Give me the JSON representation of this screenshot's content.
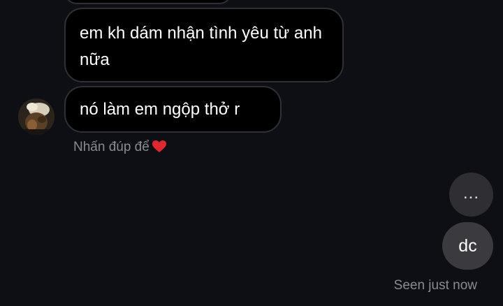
{
  "messages": [
    {
      "side": "incoming",
      "text": "em kh dám nhận tình yêu từ anh nữa"
    },
    {
      "side": "incoming",
      "text": "nó làm em ngộp thở r"
    },
    {
      "side": "outgoing",
      "text": "dc"
    }
  ],
  "typing_indicator": "...",
  "hint": {
    "text": "Nhấn đúp để",
    "icon": "heart-icon"
  },
  "seen_text": "Seen just now",
  "colors": {
    "background": "#0e0f14",
    "incoming_bubble": "#000000",
    "incoming_border": "#2f3036",
    "outgoing_bubble": "#3a3a3f",
    "meta_text": "#8a8b92",
    "heart": "#e0262f"
  }
}
